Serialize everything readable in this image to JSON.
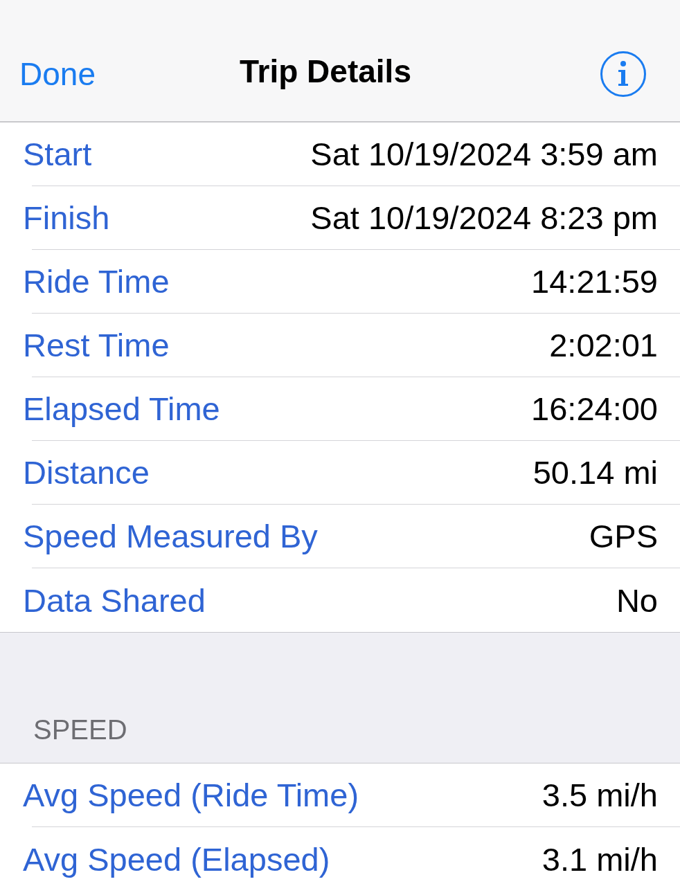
{
  "nav": {
    "back": "Done",
    "title": "Trip Details"
  },
  "sections": [
    {
      "rows": [
        {
          "label": "Start",
          "value": "Sat 10/19/2024 3:59 am"
        },
        {
          "label": "Finish",
          "value": "Sat 10/19/2024 8:23 pm"
        },
        {
          "label": "Ride Time",
          "value": "14:21:59"
        },
        {
          "label": "Rest Time",
          "value": "2:02:01"
        },
        {
          "label": "Elapsed Time",
          "value": "16:24:00"
        },
        {
          "label": "Distance",
          "value": "50.14 mi"
        },
        {
          "label": "Speed Measured By",
          "value": "GPS"
        },
        {
          "label": "Data Shared",
          "value": "No"
        }
      ]
    },
    {
      "header": "SPEED",
      "rows": [
        {
          "label": "Avg Speed (Ride Time)",
          "value": "3.5 mi/h"
        },
        {
          "label": "Avg Speed (Elapsed)",
          "value": "3.1 mi/h"
        }
      ]
    }
  ]
}
